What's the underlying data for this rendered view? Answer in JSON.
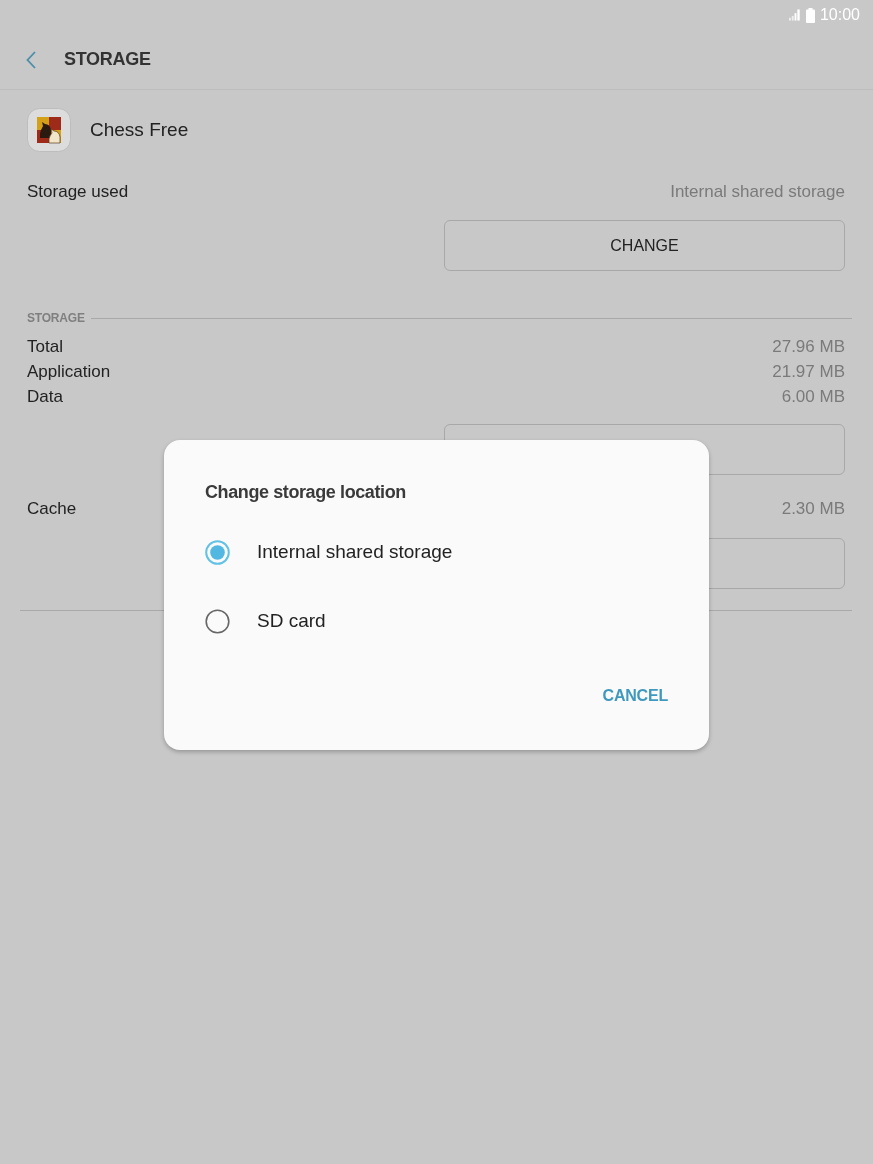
{
  "status_bar": {
    "time": "10:00"
  },
  "header": {
    "title": "STORAGE"
  },
  "app": {
    "name": "Chess Free"
  },
  "storage_used": {
    "label": "Storage used",
    "value": "Internal shared storage",
    "button": "CHANGE"
  },
  "storage_section": {
    "title": "STORAGE",
    "rows": [
      {
        "label": "Total",
        "value": "27.96 MB"
      },
      {
        "label": "Application",
        "value": "21.97 MB"
      },
      {
        "label": "Data",
        "value": "6.00 MB"
      }
    ]
  },
  "cache": {
    "label": "Cache",
    "value": "2.30 MB"
  },
  "dialog": {
    "title": "Change storage location",
    "options": [
      {
        "label": "Internal shared storage",
        "selected": true
      },
      {
        "label": "SD card",
        "selected": false
      }
    ],
    "buttons": [
      "CANCEL"
    ]
  }
}
